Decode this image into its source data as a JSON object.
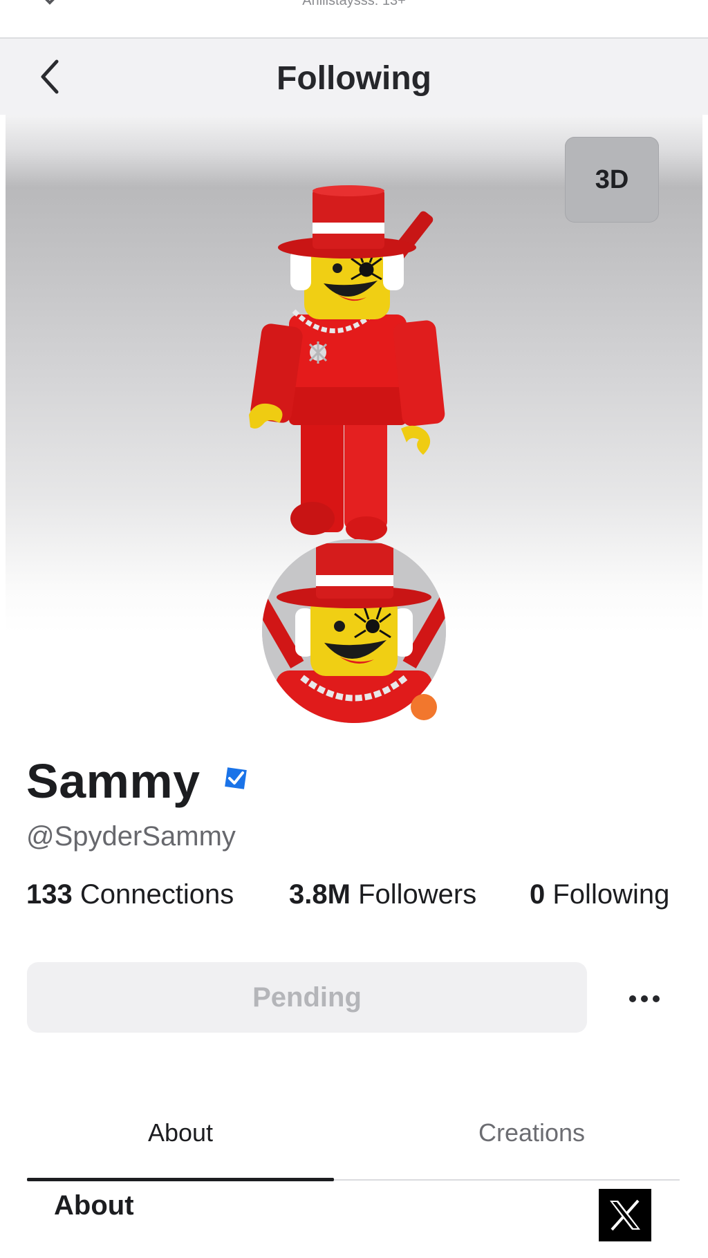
{
  "top_bar": {
    "subtitle": "Ariiiistaysss: 13+"
  },
  "header": {
    "title": "Following"
  },
  "stage": {
    "toggle_3d_label": "3D"
  },
  "profile": {
    "display_name": "Sammy",
    "username": "@SpyderSammy",
    "verified": true,
    "presence_color": "#f2772d"
  },
  "stats": {
    "connections": {
      "value": "133",
      "label": "Connections"
    },
    "followers": {
      "value": "3.8M",
      "label": "Followers"
    },
    "following": {
      "value": "0",
      "label": "Following"
    }
  },
  "actions": {
    "primary_label": "Pending"
  },
  "tabs": [
    {
      "label": "About",
      "active": true
    },
    {
      "label": "Creations",
      "active": false
    }
  ],
  "about": {
    "heading": "About"
  },
  "colors": {
    "accent_blue": "#1a73e8",
    "presence_orange": "#f2772d",
    "avatar_red": "#e01e1e",
    "avatar_yellow": "#f5d318"
  }
}
